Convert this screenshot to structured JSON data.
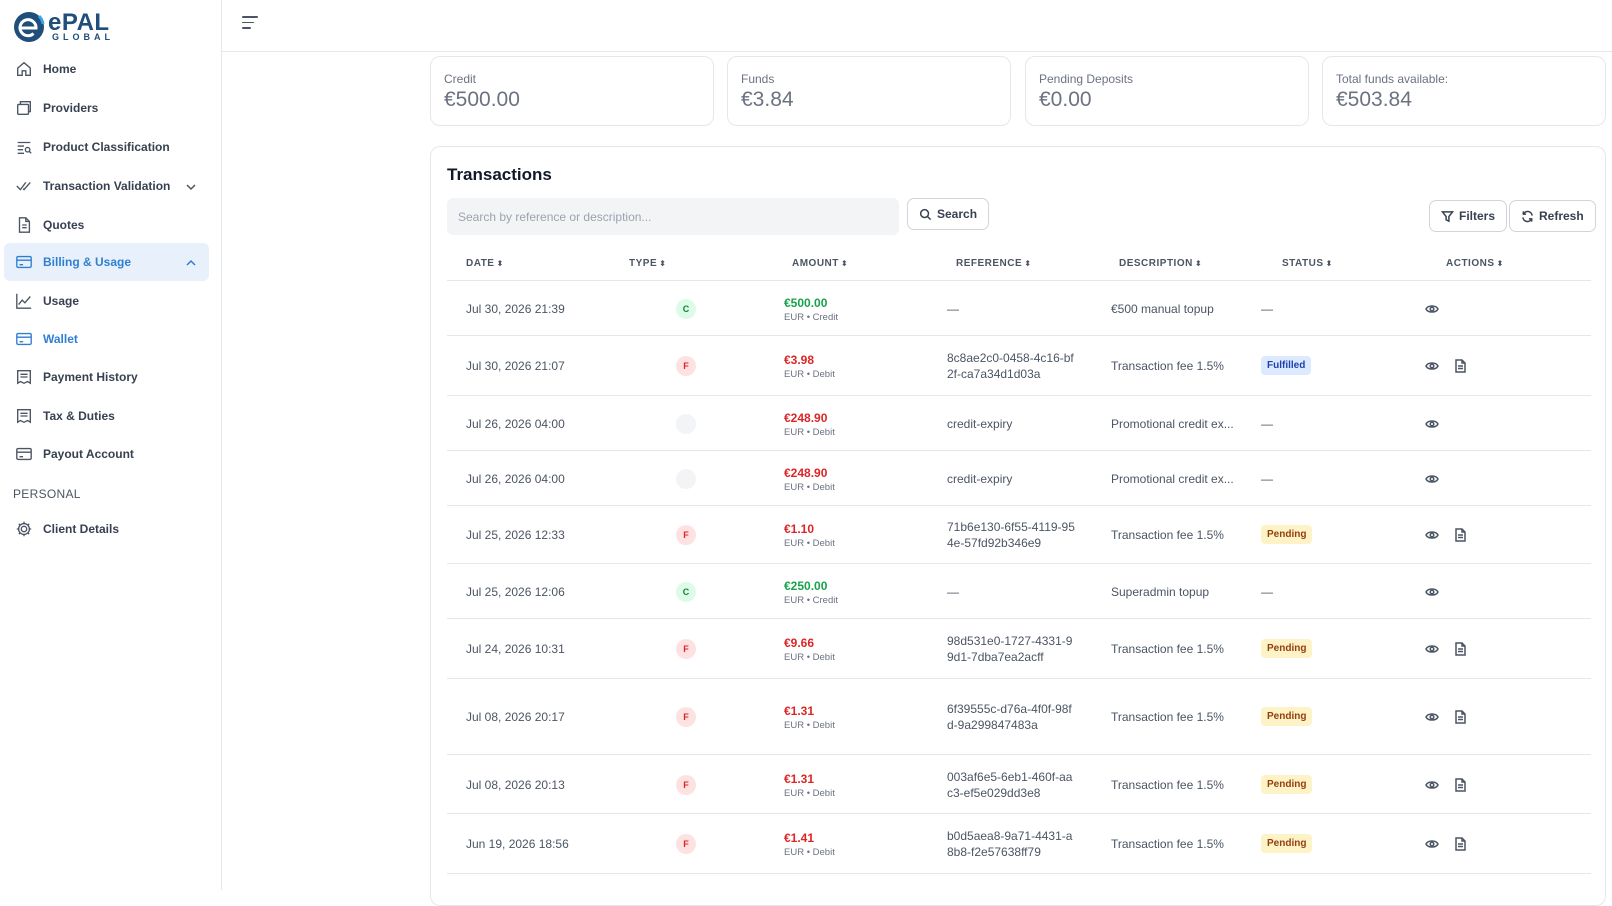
{
  "brand": {
    "name": "ePAL",
    "sub": "GLOBAL",
    "accent": "#2f7fd1"
  },
  "sidebar": {
    "items": [
      {
        "label": "Home",
        "icon": "home-icon"
      },
      {
        "label": "Providers",
        "icon": "providers-icon"
      },
      {
        "label": "Product Classification",
        "icon": "classification-icon"
      },
      {
        "label": "Transaction Validation",
        "icon": "check-double-icon"
      },
      {
        "label": "Quotes",
        "icon": "document-icon"
      },
      {
        "label": "Billing & Usage",
        "icon": "credit-card-icon"
      },
      {
        "label": "Usage",
        "icon": "chart-line-icon"
      },
      {
        "label": "Wallet",
        "icon": "wallet-icon"
      },
      {
        "label": "Payment History",
        "icon": "receipt-icon"
      },
      {
        "label": "Tax & Duties",
        "icon": "receipt-icon"
      },
      {
        "label": "Payout Account",
        "icon": "card-icon"
      }
    ],
    "section_personal": "PERSONAL",
    "personal_items": [
      {
        "label": "Client Details",
        "icon": "gear-icon"
      }
    ]
  },
  "stats": [
    {
      "title": "Credit",
      "value": "€500.00"
    },
    {
      "title": "Funds",
      "value": "€3.84"
    },
    {
      "title": "Pending Deposits",
      "value": "€0.00"
    },
    {
      "title": "Total funds available:",
      "value": "€503.84"
    }
  ],
  "transactions": {
    "title": "Transactions",
    "search_placeholder": "Search by reference or description...",
    "search_label": "Search",
    "filters_label": "Filters",
    "refresh_label": "Refresh",
    "columns": [
      "DATE",
      "TYPE",
      "AMOUNT",
      "REFERENCE",
      "DESCRIPTION",
      "STATUS",
      "ACTIONS"
    ],
    "rows": [
      {
        "date": "Jul 30, 2026 21:39",
        "type": "C",
        "amount": "€500.00",
        "amount_sub": "EUR • Credit",
        "kind": "credit",
        "reference": "—",
        "description": "€500 manual topup",
        "status": "—",
        "receipt": false
      },
      {
        "date": "Jul 30, 2026 21:07",
        "type": "F",
        "amount": "€3.98",
        "amount_sub": "EUR • Debit",
        "kind": "debit",
        "reference": "8c8ae2c0-0458-4c16-bf2f-ca7a34d1d03a",
        "description": "Transaction fee 1.5%",
        "status": "Fulfilled",
        "receipt": true
      },
      {
        "date": "Jul 26, 2026 04:00",
        "type": "",
        "amount": "€248.90",
        "amount_sub": "EUR • Debit",
        "kind": "debit",
        "reference": "credit-expiry",
        "description": "Promotional credit ex...",
        "status": "—",
        "receipt": false
      },
      {
        "date": "Jul 26, 2026 04:00",
        "type": "",
        "amount": "€248.90",
        "amount_sub": "EUR • Debit",
        "kind": "debit",
        "reference": "credit-expiry",
        "description": "Promotional credit ex...",
        "status": "—",
        "receipt": false
      },
      {
        "date": "Jul 25, 2026 12:33",
        "type": "F",
        "amount": "€1.10",
        "amount_sub": "EUR • Debit",
        "kind": "debit",
        "reference": "71b6e130-6f55-4119-954e-57fd92b346e9",
        "description": "Transaction fee 1.5%",
        "status": "Pending",
        "receipt": true
      },
      {
        "date": "Jul 25, 2026 12:06",
        "type": "C",
        "amount": "€250.00",
        "amount_sub": "EUR • Credit",
        "kind": "credit",
        "reference": "—",
        "description": "Superadmin topup",
        "status": "—",
        "receipt": false
      },
      {
        "date": "Jul 24, 2026 10:31",
        "type": "F",
        "amount": "€9.66",
        "amount_sub": "EUR • Debit",
        "kind": "debit",
        "reference": "98d531e0-1727-4331-99d1-7dba7ea2acff",
        "description": "Transaction fee 1.5%",
        "status": "Pending",
        "receipt": true
      },
      {
        "date": "Jul 08, 2026 20:17",
        "type": "F",
        "amount": "€1.31",
        "amount_sub": "EUR • Debit",
        "kind": "debit",
        "reference": "6f39555c-d76a-4f0f-98fd-9a299847483a",
        "description": "Transaction fee 1.5%",
        "status": "Pending",
        "receipt": true
      },
      {
        "date": "Jul 08, 2026 20:13",
        "type": "F",
        "amount": "€1.31",
        "amount_sub": "EUR • Debit",
        "kind": "debit",
        "reference": "003af6e5-6eb1-460f-aac3-ef5e029dd3e8",
        "description": "Transaction fee 1.5%",
        "status": "Pending",
        "receipt": true
      },
      {
        "date": "Jun 19, 2026 18:56",
        "type": "F",
        "amount": "€1.41",
        "amount_sub": "EUR • Debit",
        "kind": "debit",
        "reference": "b0d5aea8-9a71-4431-a8b8-f2e57638ff79",
        "description": "Transaction fee 1.5%",
        "status": "Pending",
        "receipt": true
      }
    ]
  }
}
